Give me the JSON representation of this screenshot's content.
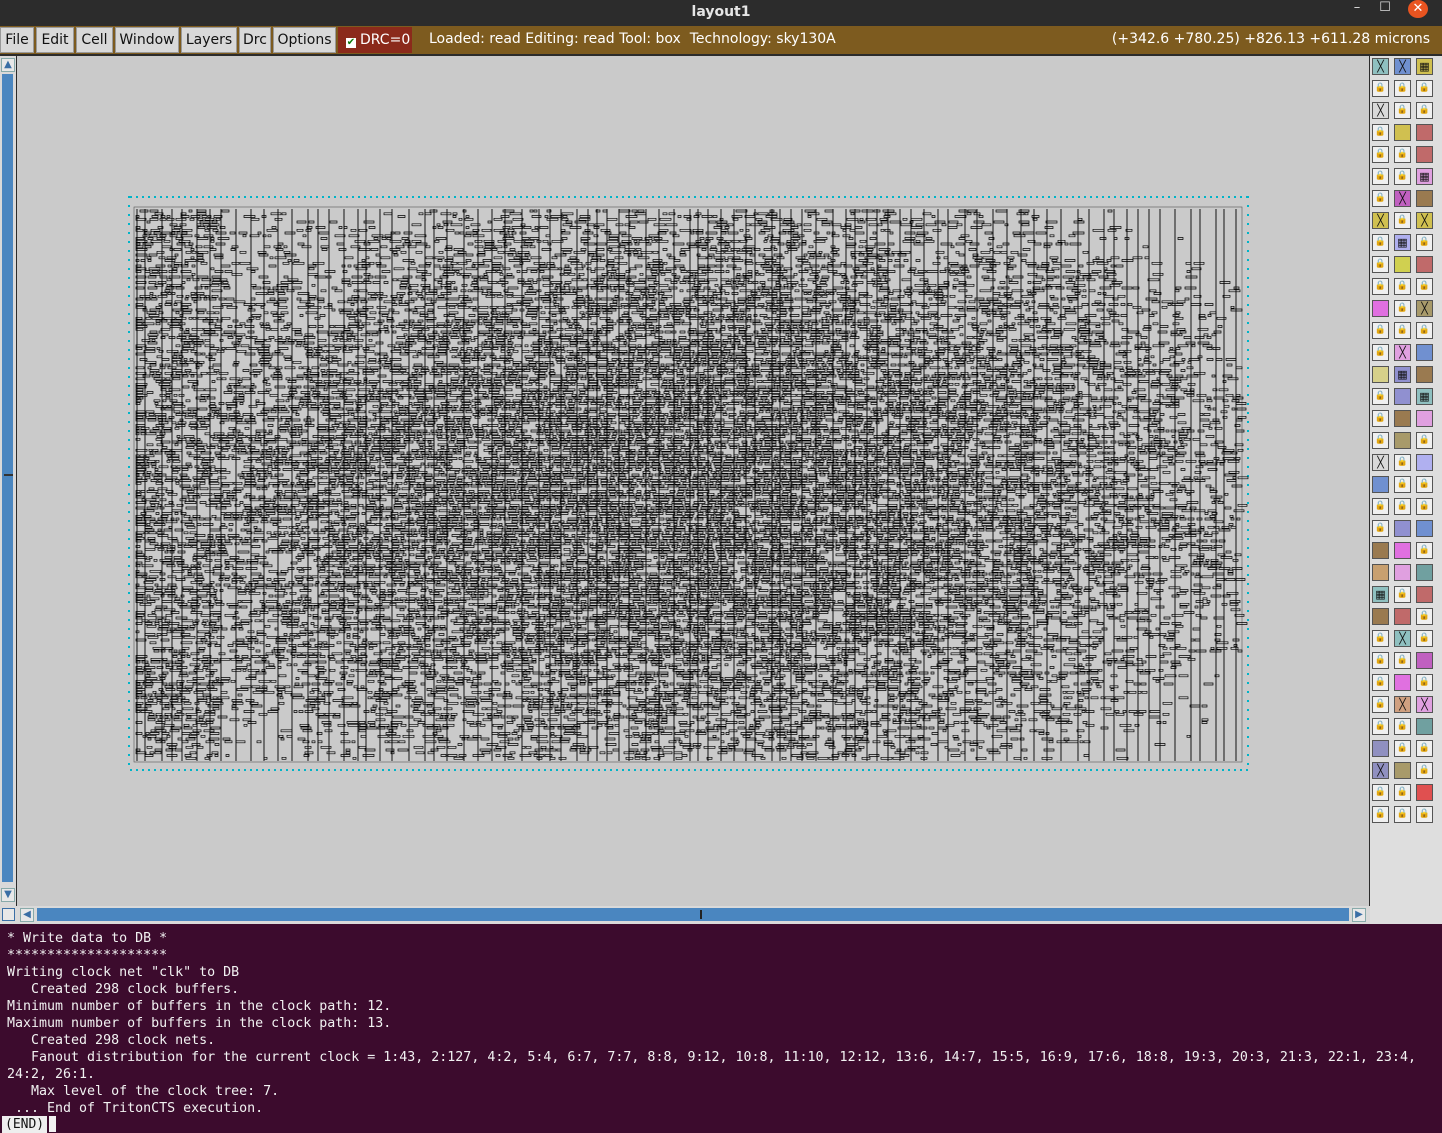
{
  "window": {
    "title": "layout1",
    "minimize_glyph": "–",
    "maximize_glyph": "☐",
    "close_glyph": "✕"
  },
  "menubar": {
    "items": [
      "File",
      "Edit",
      "Cell",
      "Window",
      "Layers",
      "Drc",
      "Options"
    ],
    "drc_label": "DRC=0",
    "drc_checked": true,
    "status": "Loaded: read Editing: read Tool: box  Technology: sky130A",
    "coordinates": "(+342.6 +780.25) +826.13 +611.28 microns"
  },
  "colors": {
    "menubar_bg": "#7d5b1f",
    "drc_bg": "#8b2a1b",
    "canvas_bg": "#cacaca",
    "scrollbar_track": "#4a86c0",
    "terminal_bg": "#3c0b2d",
    "pin_marker": "#00b4c8",
    "cell_ink": "#000000"
  },
  "layer_palette": {
    "icon_names": [
      "grid-icon",
      "hatch-icon",
      "lock-icon",
      "cross-icon",
      "stipple-icon",
      "solid-fill-icon"
    ],
    "columns": 3,
    "rows": 35
  },
  "terminal": {
    "lines": [
      "* Write data to DB *",
      "********************",
      "Writing clock net \"clk\" to DB",
      "   Created 298 clock buffers.",
      "Minimum number of buffers in the clock path: 12.",
      "Maximum number of buffers in the clock path: 13.",
      "   Created 298 clock nets.",
      "   Fanout distribution for the current clock = 1:43, 2:127, 4:2, 5:4, 6:7, 7:7, 8:8, 9:12, 10:8, 11:10, 12:12, 13:6, 14:7, 15:5, 16:9, 17:6, 18:8, 19:3, 20:3, 21:3, 22:1, 23:4,",
      "24:2, 26:1.",
      "   Max level of the clock tree: 7.",
      " ... End of TritonCTS execution."
    ],
    "prompt": "(END)"
  }
}
